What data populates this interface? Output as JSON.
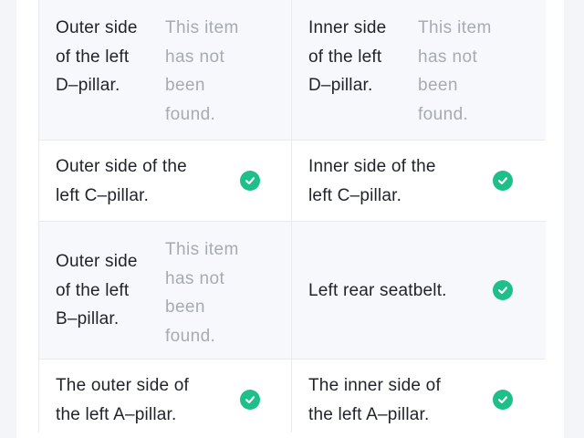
{
  "rows": [
    {
      "left": {
        "label_lines": [
          "Outer side",
          "of the left",
          "D–pillar."
        ],
        "status": "not_found",
        "status_text_lines": [
          "This item",
          "has not",
          "been",
          "found."
        ]
      },
      "right": {
        "label_lines": [
          "Inner side",
          "of the left",
          "D–pillar."
        ],
        "status": "not_found",
        "status_text_lines": [
          "This item",
          "has not",
          "been",
          "found."
        ]
      }
    },
    {
      "left": {
        "label_lines": [
          "Outer side of the",
          "left C–pillar."
        ],
        "status": "found",
        "status_icon": "check-circle-icon"
      },
      "right": {
        "label_lines": [
          "Inner side of the",
          "left C–pillar."
        ],
        "status": "found",
        "status_icon": "check-circle-icon"
      }
    },
    {
      "left": {
        "label_lines": [
          "Outer side",
          "of the left",
          "B–pillar."
        ],
        "status": "not_found",
        "status_text_lines": [
          "This item",
          "has not",
          "been",
          "found."
        ]
      },
      "right": {
        "label_lines": [
          "Left rear seatbelt."
        ],
        "status": "found",
        "status_icon": "check-circle-icon"
      }
    },
    {
      "left": {
        "label_lines": [
          "The outer side of",
          "the left A–pillar."
        ],
        "status": "found",
        "status_icon": "check-circle-icon"
      },
      "right": {
        "label_lines": [
          "The inner side of",
          "the left A–pillar."
        ],
        "status": "found",
        "status_icon": "check-circle-icon"
      }
    }
  ],
  "colors": {
    "found_green": "#1fbf8a",
    "not_found_gray": "#a6abb3",
    "label_text": "#1f2329",
    "shaded_row_bg": "#f7f8fb"
  }
}
